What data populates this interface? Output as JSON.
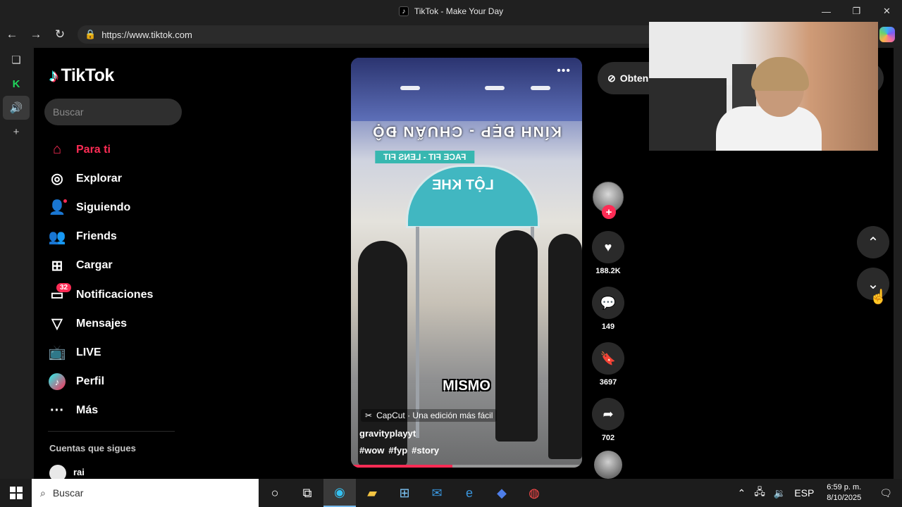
{
  "window": {
    "title": "TikTok - Make Your Day",
    "controls": [
      "—",
      "❐",
      "✕"
    ]
  },
  "browser": {
    "url": "https://www.tiktok.com",
    "strip_k": "K"
  },
  "sidebar": {
    "logo": "TikTok",
    "search_placeholder": "Buscar",
    "items": [
      {
        "label": "Para ti",
        "icon": "home-icon"
      },
      {
        "label": "Explorar",
        "icon": "compass-icon"
      },
      {
        "label": "Siguiendo",
        "icon": "following-icon"
      },
      {
        "label": "Friends",
        "icon": "friends-icon"
      },
      {
        "label": "Cargar",
        "icon": "upload-icon"
      },
      {
        "label": "Notificaciones",
        "icon": "inbox-icon",
        "badge": "32"
      },
      {
        "label": "Mensajes",
        "icon": "send-icon"
      },
      {
        "label": "LIVE",
        "icon": "live-icon"
      },
      {
        "label": "Perfil",
        "icon": "profile-icon"
      },
      {
        "label": "Más",
        "icon": "more-icon"
      }
    ],
    "following_title": "Cuentas que sigues",
    "following": [
      {
        "name": "rai"
      }
    ]
  },
  "video": {
    "overlay_title": "KÍNH ĐẸP - CHUẨN ĐỘ",
    "overlay_subtitle": "FACE FIT - LENS FIT",
    "booth_sign": "LỘT KHE",
    "subtitle": "MISMO",
    "capcut_label": "CapCut · Una edición más fácil",
    "author": "gravityplayyt",
    "hashtags": [
      "#wow",
      "#fyp",
      "#story"
    ],
    "progress": 0.44
  },
  "actions": {
    "likes": "188.2K",
    "comments": "149",
    "saves": "3697",
    "shares": "702"
  },
  "get_app_label": "Obten",
  "taskbar": {
    "search_placeholder": "Buscar",
    "language": "ESP",
    "time": "6:59 p. m.",
    "date": "8/10/2025"
  }
}
